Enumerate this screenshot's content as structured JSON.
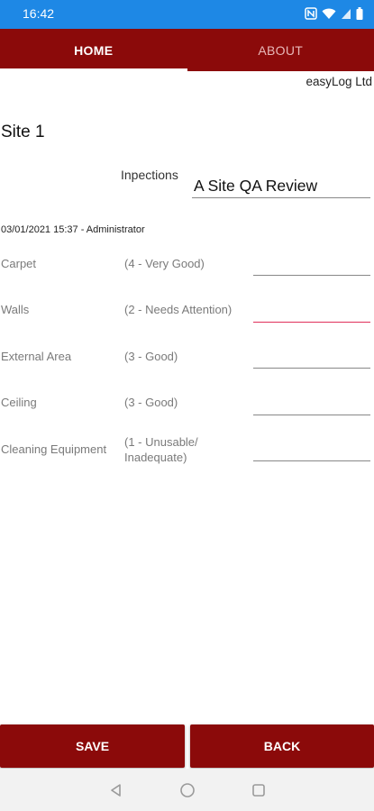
{
  "status_bar": {
    "time": "16:42"
  },
  "tabs": [
    {
      "label": "HOME",
      "active": true
    },
    {
      "label": "ABOUT",
      "active": false
    }
  ],
  "company": "easyLog Ltd",
  "site_title": "Site 1",
  "inspections": {
    "label": "Inpections",
    "value": "A Site QA Review"
  },
  "entry_meta": "03/01/2021 15:37 - Administrator",
  "rows": [
    {
      "label": "Carpet",
      "rating": "(4 - Very Good)"
    },
    {
      "label": "Walls",
      "rating": "(2 - Needs Attention)"
    },
    {
      "label": "External Area",
      "rating": "(3 - Good)"
    },
    {
      "label": "Ceiling",
      "rating": "(3 - Good)"
    },
    {
      "label": "Cleaning Equipment",
      "rating_line1": "(1 - Unusable/",
      "rating_line2": "Inadequate)"
    }
  ],
  "buttons": {
    "save": "SAVE",
    "back": "BACK"
  },
  "colors": {
    "status_bar": "#1e88e5",
    "brand": "#8b0a0a",
    "focus_underline": "#e0305a"
  },
  "nav_icons": [
    "back-triangle-icon",
    "home-circle-icon",
    "recents-square-icon"
  ]
}
